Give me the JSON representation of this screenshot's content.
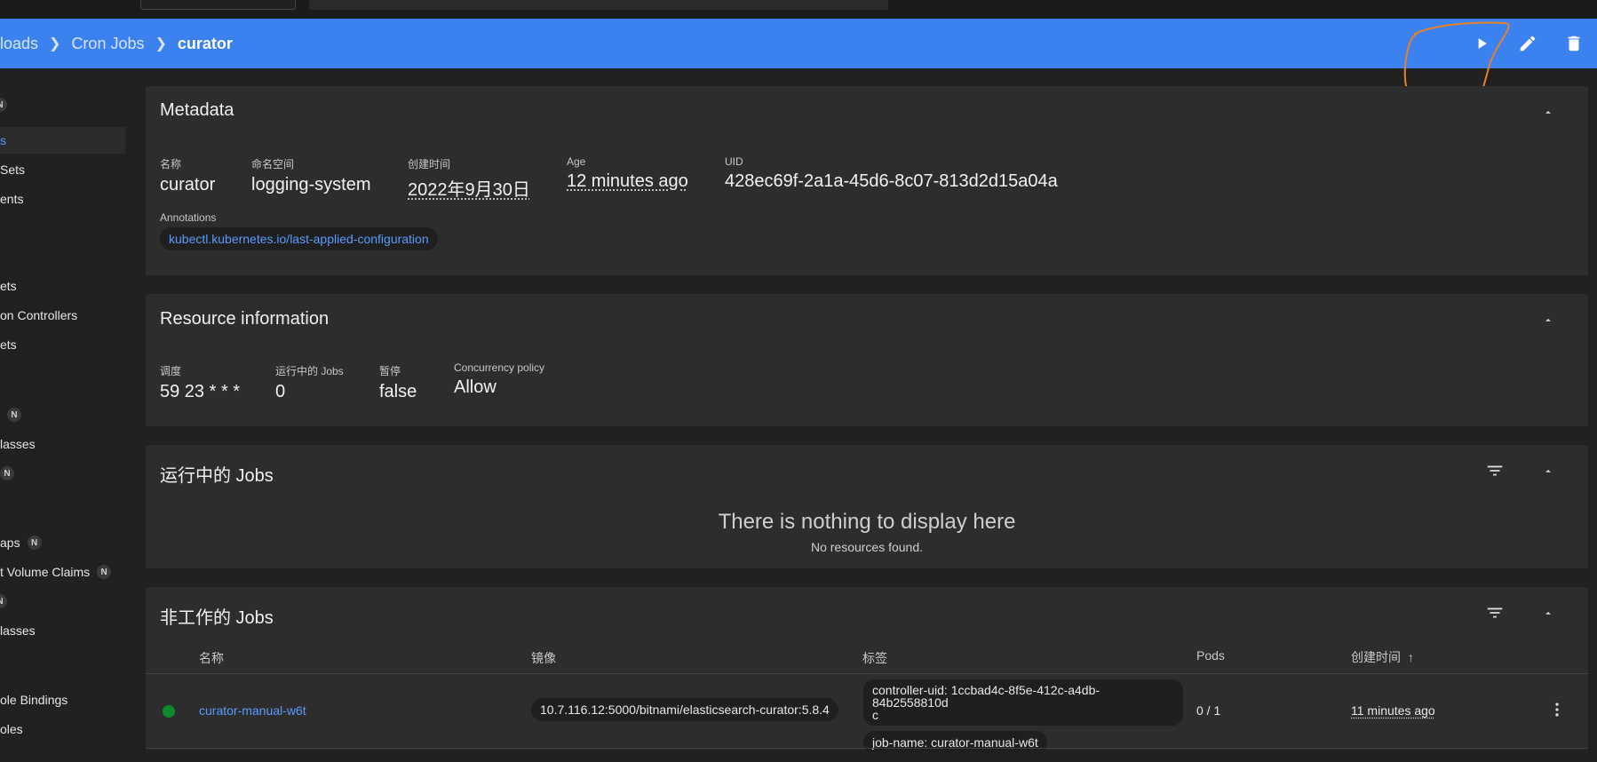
{
  "header": {
    "breadcrumb": [
      "loads",
      "Cron Jobs"
    ],
    "current": "curator",
    "actions": [
      {
        "name": "trigger",
        "icon": "play-icon"
      },
      {
        "name": "edit",
        "icon": "pencil-icon"
      },
      {
        "name": "delete",
        "icon": "trash-icon"
      }
    ],
    "colors": {
      "header_bg": "#3b82f0",
      "link": "#5b9bff",
      "status_ok": "#0f8a2b",
      "annotation": "#e8802a"
    }
  },
  "sidebar": {
    "items": [
      {
        "label": "",
        "badge": "N"
      },
      {
        "label": "s",
        "badge": "",
        "active": true
      },
      {
        "label": "Sets",
        "badge": ""
      },
      {
        "label": "ents",
        "badge": ""
      },
      {
        "label": "ets",
        "badge": ""
      },
      {
        "label": "on Controllers",
        "badge": ""
      },
      {
        "label": "ets",
        "badge": ""
      },
      {
        "label": "",
        "badge": "N"
      },
      {
        "label": "lasses",
        "badge": ""
      },
      {
        "label": "",
        "badge": "N"
      },
      {
        "label": "aps",
        "badge": "N"
      },
      {
        "label": "t Volume Claims",
        "badge": "N"
      },
      {
        "label": "",
        "badge": "N"
      },
      {
        "label": "lasses",
        "badge": ""
      },
      {
        "label": "ole Bindings",
        "badge": ""
      },
      {
        "label": "oles",
        "badge": ""
      }
    ]
  },
  "metadata": {
    "title": "Metadata",
    "fields": [
      {
        "label": "名称",
        "value": "curator"
      },
      {
        "label": "命名空间",
        "value": "logging-system"
      },
      {
        "label": "创建时间",
        "value": "2022年9月30日"
      },
      {
        "label": "Age",
        "value": "12 minutes ago"
      },
      {
        "label": "UID",
        "value": "428ec69f-2a1a-45d6-8c07-813d2d15a04a"
      }
    ],
    "annotations_label": "Annotations",
    "annotation_chip": "kubectl.kubernetes.io/last-applied-configuration"
  },
  "resource": {
    "title": "Resource information",
    "fields": [
      {
        "label": "调度",
        "value": "59 23 * * *"
      },
      {
        "label": "运行中的 Jobs",
        "value": "0"
      },
      {
        "label": "暂停",
        "value": "false"
      },
      {
        "label": "Concurrency policy",
        "value": "Allow"
      }
    ]
  },
  "active_jobs": {
    "title": "运行中的 Jobs",
    "empty_title": "There is nothing to display here",
    "empty_sub": "No resources found."
  },
  "inactive_jobs": {
    "title": "非工作的 Jobs",
    "columns": [
      "名称",
      "镜像",
      "标签",
      "Pods",
      "创建时间"
    ],
    "sort_indicator": "↑",
    "rows": [
      {
        "name": "curator-manual-w6t",
        "image": "10.7.116.12:5000/bitnami/elasticsearch-curator:5.8.4",
        "labels": [
          "controller-uid: 1ccbad4c-8f5e-412c-a4db-84b2558810dc",
          "job-name: curator-manual-w6t"
        ],
        "label_first_line": "controller-uid: 1ccbad4c-8f5e-412c-a4db-84b2558810d",
        "label_first_wrap": "c",
        "pods": "0 / 1",
        "created": "11 minutes ago",
        "status": "running"
      }
    ]
  }
}
